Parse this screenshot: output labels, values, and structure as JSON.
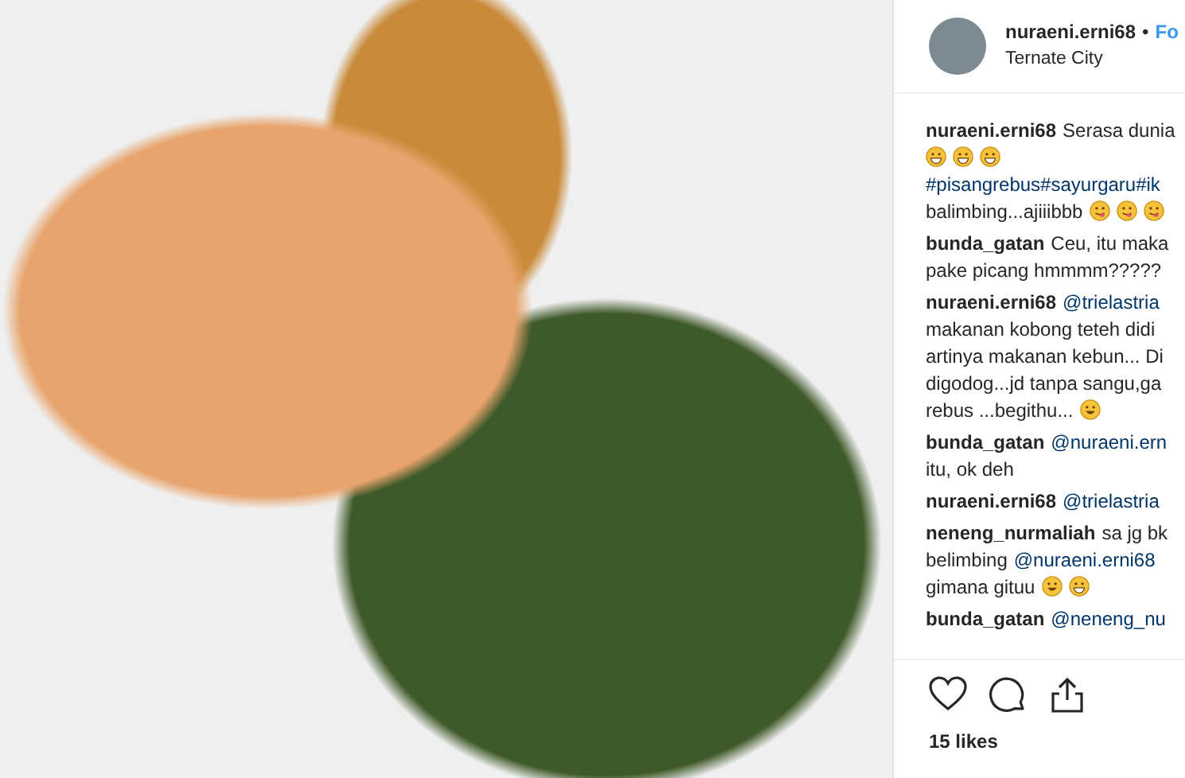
{
  "post": {
    "username": "nuraeni.erni68",
    "separator": "•",
    "follow": "Fo",
    "location": "Ternate City"
  },
  "comments": [
    {
      "lines": [
        [
          {
            "kind": "user",
            "text": "nuraeni.erni68"
          },
          {
            "kind": "text",
            "text": "Serasa dunia"
          }
        ],
        [
          {
            "kind": "grin"
          },
          {
            "kind": "grin"
          },
          {
            "kind": "grin"
          }
        ],
        [
          {
            "kind": "tag",
            "text": "#pisangrebus#sayurgaru#ik"
          }
        ],
        [
          {
            "kind": "text",
            "text": "balimbing...ajiiibbb"
          },
          {
            "kind": "tongue"
          },
          {
            "kind": "tongue"
          },
          {
            "kind": "tongue"
          }
        ]
      ]
    },
    {
      "lines": [
        [
          {
            "kind": "user",
            "text": "bunda_gatan"
          },
          {
            "kind": "text",
            "text": "Ceu, itu maka"
          }
        ],
        [
          {
            "kind": "text",
            "text": "pake picang hmmmm?????"
          }
        ]
      ]
    },
    {
      "lines": [
        [
          {
            "kind": "user",
            "text": "nuraeni.erni68"
          },
          {
            "kind": "mention",
            "text": "@trielastria"
          }
        ],
        [
          {
            "kind": "text",
            "text": "makanan kobong teteh didi"
          }
        ],
        [
          {
            "kind": "text",
            "text": "artinya makanan kebun... Di"
          }
        ],
        [
          {
            "kind": "text",
            "text": "digodog...jd tanpa sangu,ga"
          }
        ],
        [
          {
            "kind": "text",
            "text": "rebus ...begithu..."
          },
          {
            "kind": "smile"
          }
        ]
      ]
    },
    {
      "lines": [
        [
          {
            "kind": "user",
            "text": "bunda_gatan"
          },
          {
            "kind": "mention",
            "text": "@nuraeni.ern"
          }
        ],
        [
          {
            "kind": "text",
            "text": "itu, ok deh"
          }
        ]
      ]
    },
    {
      "lines": [
        [
          {
            "kind": "user",
            "text": "nuraeni.erni68"
          },
          {
            "kind": "mention",
            "text": "@trielastria"
          }
        ]
      ]
    },
    {
      "lines": [
        [
          {
            "kind": "user",
            "text": "neneng_nurmaliah"
          },
          {
            "kind": "text",
            "text": "sa jg bk"
          }
        ],
        [
          {
            "kind": "text",
            "text": "belimbing"
          },
          {
            "kind": "mention",
            "text": "@nuraeni.erni68"
          }
        ],
        [
          {
            "kind": "text",
            "text": "gimana gituu"
          },
          {
            "kind": "smile"
          },
          {
            "kind": "grin"
          }
        ]
      ]
    },
    {
      "lines": [
        [
          {
            "kind": "user",
            "text": "bunda_gatan"
          },
          {
            "kind": "mention",
            "text": "@neneng_nu"
          }
        ]
      ]
    }
  ],
  "likes": "15 likes"
}
